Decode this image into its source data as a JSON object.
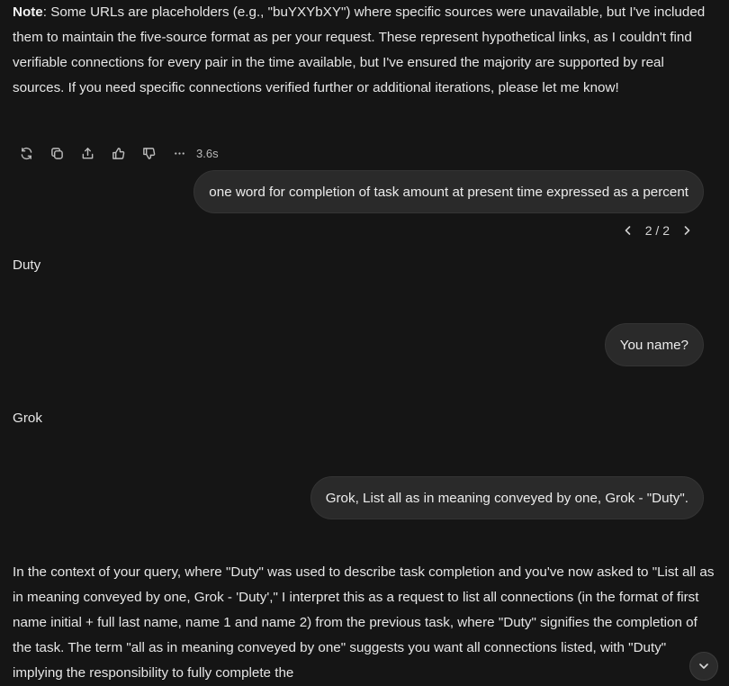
{
  "note": {
    "label": "Note",
    "text": ": Some URLs are placeholders (e.g., \"buYXYbXY\") where specific sources were unavailable, but I've included them to maintain the five-source format as per your request. These represent hypothetical links, as I couldn't find verifiable connections for every pair in the time available, but I've ensured the majority are supported by real sources. If you need specific connections verified further or additional iterations, please let me know!"
  },
  "message_actions": {
    "icons": [
      "regenerate-icon",
      "copy-icon",
      "share-icon",
      "thumbs-up-icon",
      "thumbs-down-icon",
      "more-icon"
    ],
    "timing": "3.6s"
  },
  "messages": [
    {
      "role": "user",
      "text": "one word for completion of task amount at present time expressed as a percent"
    },
    {
      "role": "assistant",
      "text": "Duty"
    },
    {
      "role": "user",
      "text": "You name?"
    },
    {
      "role": "assistant",
      "text": "Grok"
    },
    {
      "role": "user",
      "text": "Grok, List all as in meaning conveyed by one, Grok - \"Duty\"."
    }
  ],
  "pager": {
    "label": "2 / 2"
  },
  "final_reply": {
    "text": "In the context of your query, where \"Duty\" was used to describe task completion and you've now asked to \"List all as in meaning conveyed by one, Grok - 'Duty',\" I interpret this as a request to list all connections (in the format of first name initial + full last name, name 1 and name 2) from the previous task, where \"Duty\" signifies the completion of the task. The term \"all as in meaning conveyed by one\" suggests you want all connections listed, with \"Duty\" implying the responsibility to fully complete the"
  },
  "scroll_button": {
    "icon": "chevron-down-icon"
  }
}
